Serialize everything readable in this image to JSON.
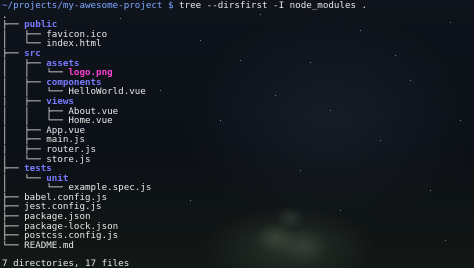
{
  "terminal": {
    "prompt": "~/projects/my-awesome-project $",
    "command": " tree --dirsfirst -I node_modules .",
    "tree": [
      {
        "prefix": ".",
        "name": "",
        "kind": "file"
      },
      {
        "prefix": "├── ",
        "name": "public",
        "kind": "dir"
      },
      {
        "prefix": "│   ├── ",
        "name": "favicon.ico",
        "kind": "file"
      },
      {
        "prefix": "│   └── ",
        "name": "index.html",
        "kind": "file"
      },
      {
        "prefix": "├── ",
        "name": "src",
        "kind": "dir"
      },
      {
        "prefix": "│   ├── ",
        "name": "assets",
        "kind": "dir"
      },
      {
        "prefix": "│   │   └── ",
        "name": "logo.png",
        "kind": "img"
      },
      {
        "prefix": "│   ├── ",
        "name": "components",
        "kind": "dir"
      },
      {
        "prefix": "│   │   └── ",
        "name": "HelloWorld.vue",
        "kind": "file"
      },
      {
        "prefix": "│   ├── ",
        "name": "views",
        "kind": "dir"
      },
      {
        "prefix": "│   │   ├── ",
        "name": "About.vue",
        "kind": "file"
      },
      {
        "prefix": "│   │   └── ",
        "name": "Home.vue",
        "kind": "file"
      },
      {
        "prefix": "│   ├── ",
        "name": "App.vue",
        "kind": "file"
      },
      {
        "prefix": "│   ├── ",
        "name": "main.js",
        "kind": "file"
      },
      {
        "prefix": "│   ├── ",
        "name": "router.js",
        "kind": "file"
      },
      {
        "prefix": "│   └── ",
        "name": "store.js",
        "kind": "file"
      },
      {
        "prefix": "├── ",
        "name": "tests",
        "kind": "dir"
      },
      {
        "prefix": "│   └── ",
        "name": "unit",
        "kind": "dir"
      },
      {
        "prefix": "│       └── ",
        "name": "example.spec.js",
        "kind": "file"
      },
      {
        "prefix": "├── ",
        "name": "babel.config.js",
        "kind": "file"
      },
      {
        "prefix": "├── ",
        "name": "jest.config.js",
        "kind": "file"
      },
      {
        "prefix": "├── ",
        "name": "package.json",
        "kind": "file"
      },
      {
        "prefix": "├── ",
        "name": "package-lock.json",
        "kind": "file"
      },
      {
        "prefix": "├── ",
        "name": "postcss.config.js",
        "kind": "file"
      },
      {
        "prefix": "└── ",
        "name": "README.md",
        "kind": "file"
      }
    ],
    "summary": "7 directories, 17 files"
  },
  "colors": {
    "prompt": "#7fa8ff",
    "directory": "#7a7aff",
    "image_file": "#ff3fd2",
    "text": "#e6e6e6",
    "background": "#0b0d12"
  }
}
